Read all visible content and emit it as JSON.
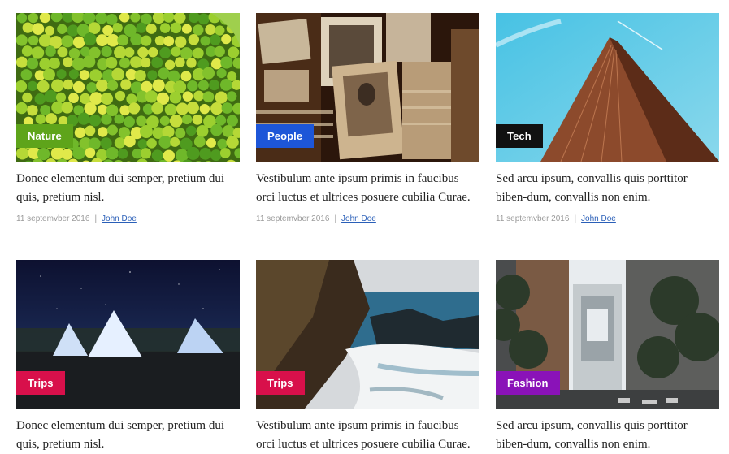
{
  "cards": [
    {
      "category": "Nature",
      "category_color": "#5ea41a",
      "image": "green-fruits-image",
      "title": "Donec elementum dui semper, pretium dui quis, pretium nisl.",
      "date": "11 septemvber 2016",
      "separator": "|",
      "author": "John Doe"
    },
    {
      "category": "People",
      "category_color": "#1d56d8",
      "image": "old-photographs-image",
      "title": "Vestibulum ante ipsum primis in faucibus orci luctus et ultrices posuere cubilia Curae.",
      "date": "11 septemvber 2016",
      "separator": "|",
      "author": "John Doe"
    },
    {
      "category": "Tech",
      "category_color": "#111111",
      "image": "skyscraper-image",
      "title": "Sed arcu ipsum, convallis quis porttitor biben-dum, convallis non enim.",
      "date": "11 septemvber 2016",
      "separator": "|",
      "author": "John Doe"
    },
    {
      "category": "Trips",
      "category_color": "#d8104b",
      "image": "tents-night-image",
      "title": "Donec elementum dui semper, pretium dui quis, pretium nisl.",
      "date": "",
      "separator": "",
      "author": ""
    },
    {
      "category": "Trips",
      "category_color": "#d8104b",
      "image": "coast-waves-image",
      "title": "Vestibulum ante ipsum primis in faucibus orci luctus et ultrices posuere cubilia Curae.",
      "date": "",
      "separator": "",
      "author": ""
    },
    {
      "category": "Fashion",
      "category_color": "#8a12b8",
      "image": "city-bridge-image",
      "title": "Sed arcu ipsum, convallis quis porttitor biben-dum, convallis non enim.",
      "date": "",
      "separator": "",
      "author": ""
    }
  ]
}
